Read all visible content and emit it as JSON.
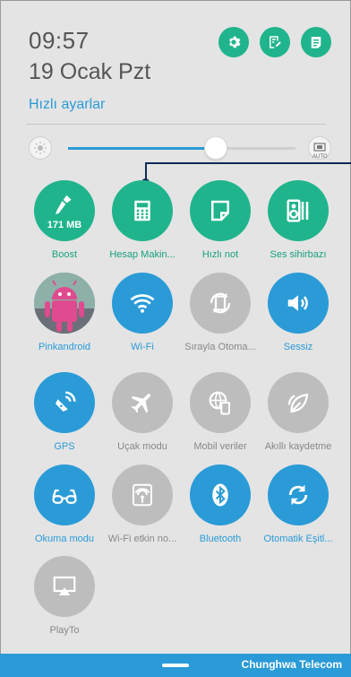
{
  "header": {
    "time": "09:57",
    "date": "19 Ocak Pzt",
    "quick_settings_title": "Hızlı ayarlar"
  },
  "brightness": {
    "level": 0.65,
    "auto_label": "AUTO"
  },
  "tiles": [
    {
      "label": "Boost",
      "value": "171 MB",
      "icon": "broom-icon",
      "state": "on-green"
    },
    {
      "label": "Hesap Makin...",
      "icon": "calculator-icon",
      "state": "on-green"
    },
    {
      "label": "Hızlı not",
      "icon": "note-icon",
      "state": "on-green"
    },
    {
      "label": "Ses sihirbazı",
      "icon": "speaker-equalizer-icon",
      "state": "on-green"
    },
    {
      "label": "Pinkandroid",
      "icon": "avatar",
      "state": "avatar"
    },
    {
      "label": "Wi-Fi",
      "icon": "wifi-icon",
      "state": "on-blue"
    },
    {
      "label": "Sırayla Otoma...",
      "icon": "auto-rotate-icon",
      "state": "off"
    },
    {
      "label": "Sessiz",
      "icon": "speaker-sound-icon",
      "state": "on-blue"
    },
    {
      "label": "GPS",
      "icon": "gps-icon",
      "state": "on-blue"
    },
    {
      "label": "Uçak modu",
      "icon": "airplane-icon",
      "state": "off"
    },
    {
      "label": "Mobil veriler",
      "icon": "mobile-data-icon",
      "state": "off"
    },
    {
      "label": "Akıllı kaydetme",
      "icon": "leaf-icon",
      "state": "off"
    },
    {
      "label": "Okuma modu",
      "icon": "glasses-icon",
      "state": "on-blue"
    },
    {
      "label": "Wi-Fi etkin no...",
      "icon": "hotspot-icon",
      "state": "off"
    },
    {
      "label": "Bluetooth",
      "icon": "bluetooth-icon",
      "state": "on-blue"
    },
    {
      "label": "Otomatik Eşitl...",
      "icon": "sync-icon",
      "state": "on-blue"
    },
    {
      "label": "PlayTo",
      "icon": "cast-icon",
      "state": "off"
    }
  ],
  "status_bar": {
    "carrier": "Chunghwa Telecom"
  },
  "colors": {
    "green": "#20b48d",
    "blue": "#2a9bd7",
    "off": "#bdbdbd"
  }
}
